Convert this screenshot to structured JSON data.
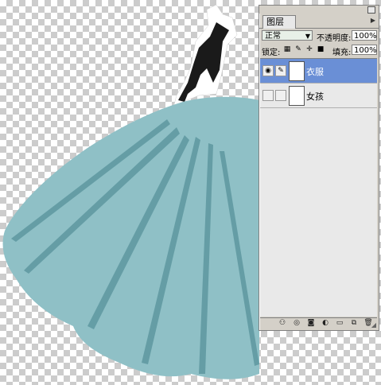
{
  "panel": {
    "tab_label": "图层",
    "blend_mode": "正常",
    "opacity_label": "不透明度:",
    "opacity_value": "100%",
    "lock_label": "锁定:",
    "fill_label": "填充:",
    "fill_value": "100%",
    "layers": [
      {
        "name": "衣服",
        "selected": true,
        "visible": true
      },
      {
        "name": "女孩",
        "selected": false,
        "visible": false
      }
    ],
    "bottom_icons": [
      "link-icon",
      "layer-style-icon",
      "mask-icon",
      "adjustment-icon",
      "new-group-icon",
      "new-layer-icon",
      "trash-icon"
    ]
  },
  "colors": {
    "dress": "#8fc0c6",
    "dress_fold": "#5e98a0",
    "selection": "#6a8fd6"
  }
}
